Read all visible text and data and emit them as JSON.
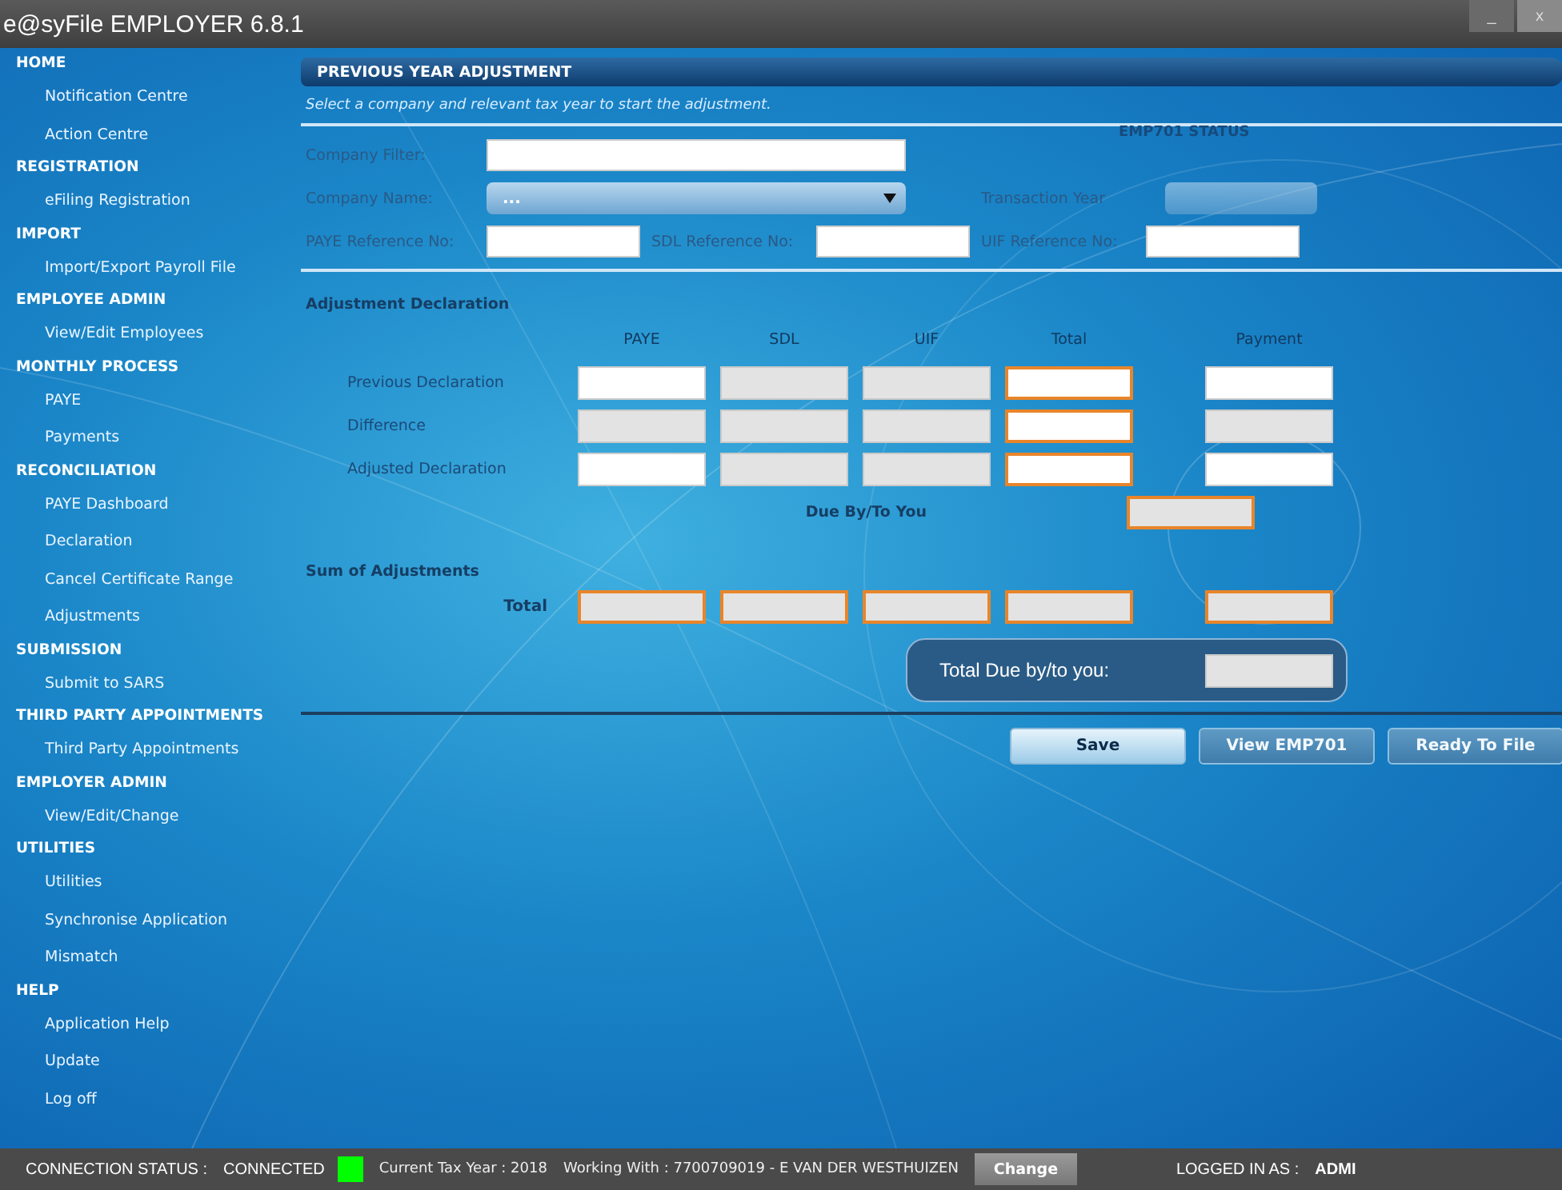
{
  "window": {
    "title": "e@syFile EMPLOYER 6.8.1",
    "controls": [
      "_",
      "x"
    ]
  },
  "sidebar": {
    "sections": [
      {
        "title": "HOME",
        "items": [
          {
            "label": "Notification Centre",
            "selected": false
          },
          {
            "label": "Action Centre",
            "selected": false
          }
        ]
      },
      {
        "title": "REGISTRATION",
        "items": [
          {
            "label": "eFiling Registration",
            "selected": false
          }
        ]
      },
      {
        "title": "IMPORT",
        "items": [
          {
            "label": "Import/Export Payroll File",
            "selected": false
          }
        ]
      },
      {
        "title": "EMPLOYEE ADMIN",
        "items": [
          {
            "label": "View/Edit Employees",
            "selected": false
          }
        ]
      },
      {
        "title": "MONTHLY PROCESS",
        "items": [
          {
            "label": "PAYE",
            "selected": false
          },
          {
            "label": "Payments",
            "selected": false
          }
        ]
      },
      {
        "title": "RECONCILIATION",
        "items": [
          {
            "label": "PAYE Dashboard",
            "selected": false
          },
          {
            "label": "Declaration",
            "selected": false
          },
          {
            "label": "Cancel Certificate Range",
            "selected": false
          },
          {
            "label": "Adjustments",
            "selected": false
          }
        ]
      },
      {
        "title": "SUBMISSION",
        "items": [
          {
            "label": "Submit to SARS",
            "selected": false
          }
        ]
      },
      {
        "title": "THIRD PARTY APPOINTMENTS",
        "items": [
          {
            "label": "Third Party Appointments",
            "selected": false
          }
        ]
      },
      {
        "title": "EMPLOYER ADMIN",
        "items": [
          {
            "label": "View/Edit/Change",
            "selected": false
          }
        ]
      },
      {
        "title": "UTILITIES",
        "items": [
          {
            "label": "Utilities",
            "selected": false
          },
          {
            "label": "Synchronise Application",
            "selected": false
          },
          {
            "label": "Mismatch",
            "selected": false
          }
        ]
      },
      {
        "title": "HELP",
        "items": [
          {
            "label": "Application Help",
            "selected": false
          },
          {
            "label": "Update",
            "selected": false
          },
          {
            "label": "Log off",
            "selected": false
          }
        ]
      }
    ]
  },
  "panel": {
    "title": "PREVIOUS YEAR ADJUSTMENT",
    "hint": "Select a company and relevant tax year to start the adjustment.",
    "status_label": "EMP701 STATUS",
    "company_filter": {
      "label": "Company Filter:"
    },
    "company_name": {
      "label": "Company Name:",
      "value": "..."
    },
    "transaction_year": {
      "label": "Transaction Year",
      "disabled": true
    },
    "references": [
      {
        "label": "PAYE Reference No:"
      },
      {
        "label": "SDL Reference No:"
      },
      {
        "label": "UIF Reference No:"
      }
    ],
    "declaration": {
      "title": "Adjustment Declaration",
      "columns": [
        "PAYE",
        "SDL",
        "UIF",
        "Total",
        "Payment"
      ],
      "rows": [
        {
          "label": "Previous Declaration",
          "cells": [
            {
              "disabled": false,
              "emphasized": false
            },
            {
              "disabled": true,
              "emphasized": false
            },
            {
              "disabled": true,
              "emphasized": false
            },
            {
              "disabled": false,
              "emphasized": true
            },
            {
              "disabled": false,
              "emphasized": false
            }
          ]
        },
        {
          "label": "Difference",
          "cells": [
            {
              "disabled": true,
              "emphasized": false
            },
            {
              "disabled": true,
              "emphasized": false
            },
            {
              "disabled": true,
              "emphasized": false
            },
            {
              "disabled": false,
              "emphasized": true
            },
            {
              "disabled": true,
              "emphasized": false
            }
          ]
        },
        {
          "label": "Adjusted Declaration",
          "cells": [
            {
              "disabled": false,
              "emphasized": false
            },
            {
              "disabled": true,
              "emphasized": false
            },
            {
              "disabled": true,
              "emphasized": false
            },
            {
              "disabled": false,
              "emphasized": true
            },
            {
              "disabled": false,
              "emphasized": false
            }
          ]
        }
      ],
      "due": {
        "label": "Due By/To You",
        "disabled": true,
        "emphasized": true
      }
    },
    "sum": {
      "title": "Sum of Adjustments",
      "total_label": "Total",
      "cells": [
        {
          "disabled": true,
          "emphasized": true
        },
        {
          "disabled": true,
          "emphasized": true
        },
        {
          "disabled": true,
          "emphasized": true
        },
        {
          "disabled": true,
          "emphasized": true
        },
        {
          "disabled": true,
          "emphasized": true
        }
      ]
    },
    "total_due": {
      "label": "Total Due by/to you:",
      "disabled": true
    },
    "buttons": [
      {
        "label": "Save",
        "disabled": false
      },
      {
        "label": "View EMP701",
        "disabled": true
      },
      {
        "label": "Ready To File",
        "disabled": true
      }
    ]
  },
  "status_bar": {
    "connection_label": "CONNECTION STATUS :",
    "connection_value": "CONNECTED",
    "online": true,
    "tax_year": "Current Tax Year : 2018",
    "working_with": "Working With : 7700709019 - E VAN DER WESTHUIZEN",
    "change_button": "Change",
    "logged_in_label": "LOGGED IN AS :",
    "logged_in_user": "ADMI"
  }
}
